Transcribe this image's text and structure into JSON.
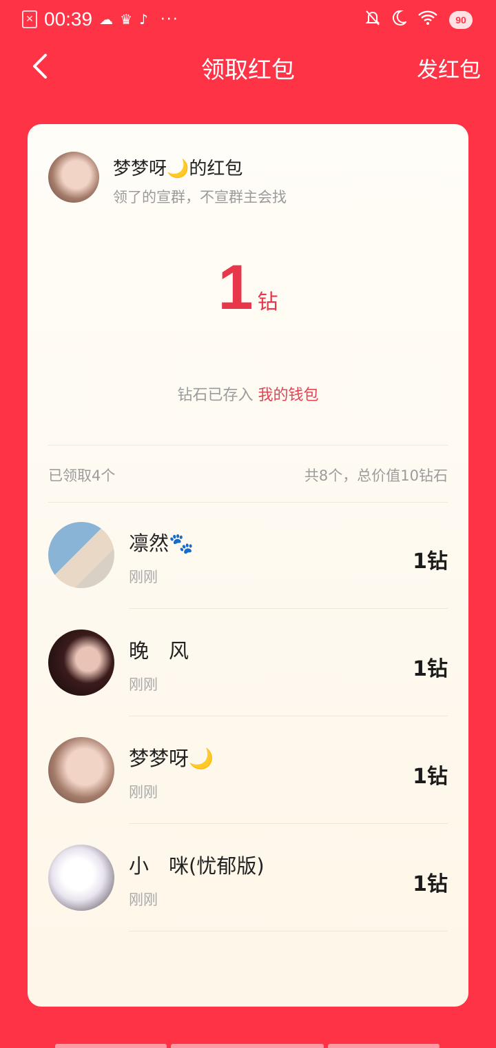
{
  "status_bar": {
    "time": "00:39",
    "battery": "90",
    "more": "···"
  },
  "nav": {
    "title": "领取红包",
    "action": "发红包"
  },
  "sender": {
    "name": "梦梦呀🌙的红包",
    "message": "领了的宣群，不宣群主会找"
  },
  "amount": {
    "value": "1",
    "unit": "钻"
  },
  "wallet": {
    "prefix": "钻石已存入",
    "link": "我的钱包"
  },
  "summary": {
    "claimed": "已领取4个",
    "total": "共8个，总价值10钻石"
  },
  "claims": [
    {
      "name": "凛然🐾",
      "time": "刚刚",
      "value": "1钻"
    },
    {
      "name": "晚　风",
      "time": "刚刚",
      "value": "1钻"
    },
    {
      "name": "梦梦呀🌙",
      "time": "刚刚",
      "value": "1钻"
    },
    {
      "name": "小　咪(忧郁版)",
      "time": "刚刚",
      "value": "1钻"
    }
  ],
  "colors": {
    "background": "#FF3346",
    "accent": "#E8374B",
    "card": "#FEF7EB"
  },
  "icons": [
    "back-arrow-icon",
    "close-box-icon",
    "cloud-icon",
    "crown-icon",
    "music-icon",
    "bell-off-icon",
    "moon-icon",
    "wifi-icon",
    "battery-icon"
  ]
}
